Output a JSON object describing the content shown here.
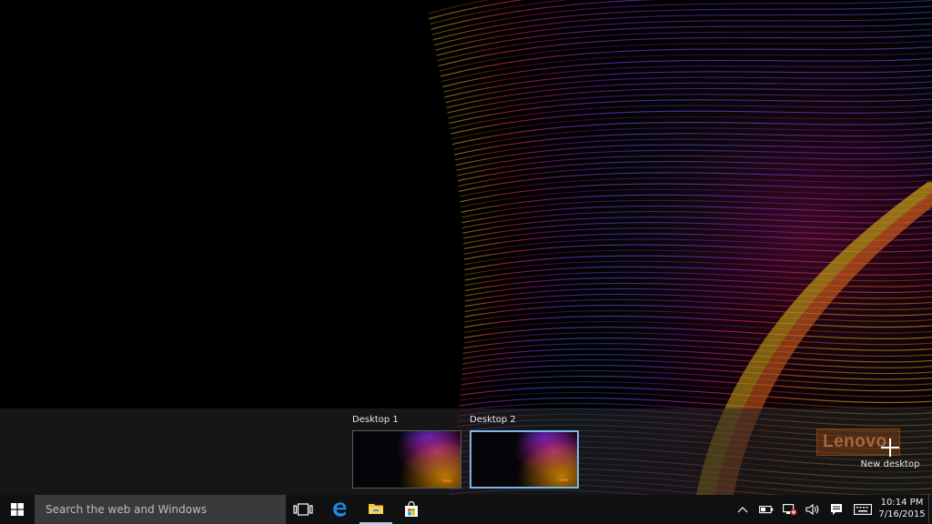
{
  "task_view": {
    "desktops": [
      {
        "label": "Desktop 1",
        "selected": false
      },
      {
        "label": "Desktop 2",
        "selected": true
      }
    ],
    "new_desktop_label": "New desktop"
  },
  "watermark": {
    "text": "Lenovo"
  },
  "taskbar": {
    "start_icon": "windows-logo-icon",
    "search_placeholder": "Search the web and Windows",
    "pinned_apps": [
      "task-view-icon",
      "edge-icon",
      "file-explorer-icon",
      "store-icon"
    ]
  },
  "tray": {
    "icons": [
      "chevron-up-icon",
      "battery-icon",
      "network-icon",
      "volume-icon",
      "action-center-icon",
      "keyboard-icon"
    ],
    "time": "10:14 PM",
    "date": "7/16/2015"
  },
  "colors": {
    "taskbar": "#101010",
    "search_box": "#3a3a3a",
    "selected_border": "#7fb6e8",
    "edge_blue": "#1e88e5",
    "explorer_yellow": "#f2c12e"
  }
}
